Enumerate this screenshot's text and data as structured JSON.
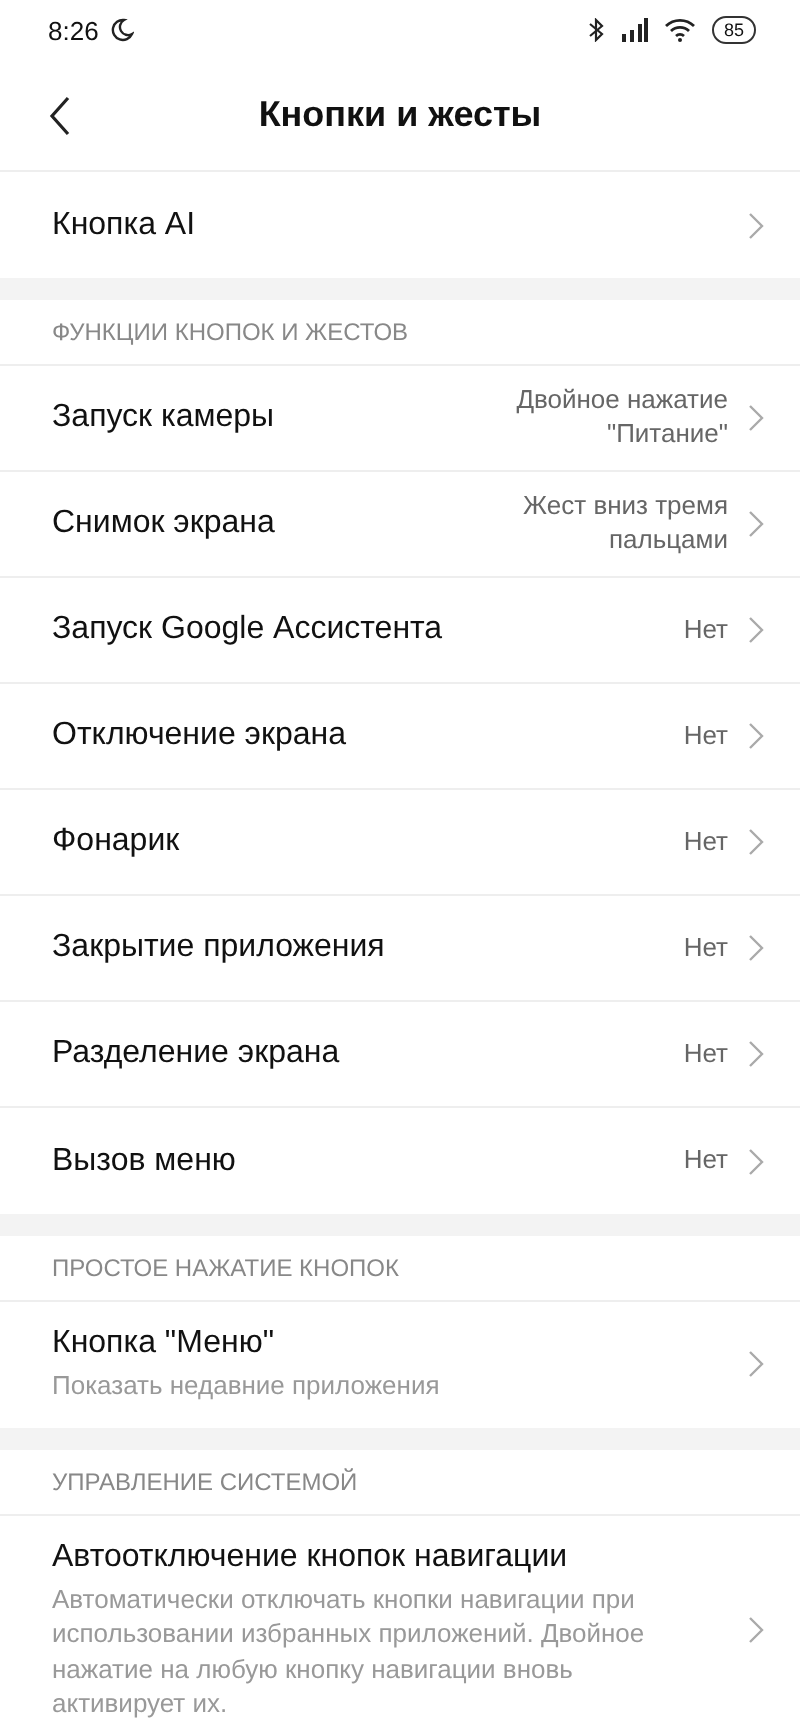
{
  "status_bar": {
    "time": "8:26",
    "battery": "85"
  },
  "header": {
    "title": "Кнопки и жесты"
  },
  "sections": [
    {
      "items": [
        {
          "title": "Кнопка AI"
        }
      ]
    },
    {
      "header": "ФУНКЦИИ КНОПОК И ЖЕСТОВ",
      "items": [
        {
          "title": "Запуск камеры",
          "value": "Двойное нажатие \"Питание\""
        },
        {
          "title": "Снимок экрана",
          "value": "Жест вниз тремя пальцами"
        },
        {
          "title": "Запуск Google Ассистента",
          "value": "Нет"
        },
        {
          "title": "Отключение экрана",
          "value": "Нет"
        },
        {
          "title": "Фонарик",
          "value": "Нет"
        },
        {
          "title": "Закрытие приложения",
          "value": "Нет"
        },
        {
          "title": "Разделение экрана",
          "value": "Нет"
        },
        {
          "title": "Вызов меню",
          "value": "Нет"
        }
      ]
    },
    {
      "header": "ПРОСТОЕ НАЖАТИЕ КНОПОК",
      "items": [
        {
          "title": "Кнопка \"Меню\"",
          "subtitle": "Показать недавние приложения"
        }
      ]
    },
    {
      "header": "УПРАВЛЕНИЕ СИСТЕМОЙ",
      "items": [
        {
          "title": "Автоотключение кнопок навигации",
          "subtitle": "Автоматически отключать кнопки навигации при использовании избранных приложений. Двойное нажатие на любую кнопку навигации вновь активирует их."
        }
      ]
    }
  ]
}
